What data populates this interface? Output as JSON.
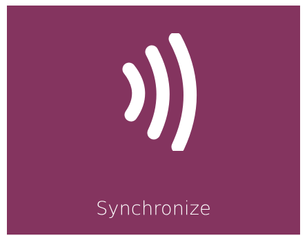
{
  "tile": {
    "label": "Synchronize",
    "background_color": "#84345F",
    "icon_color": "#FFFFFF",
    "icon": "sync-waves-icon"
  }
}
